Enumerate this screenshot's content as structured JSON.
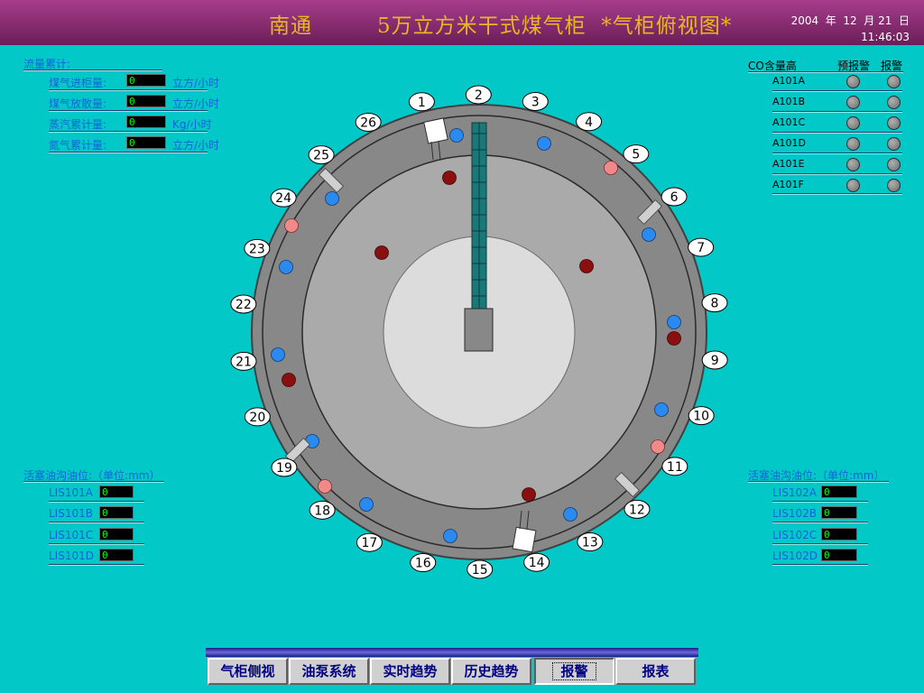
{
  "header": {
    "title": "南通　　　5万立方米干式煤气柜  *气柜俯视图*",
    "date": "2004  年  12  月 21  日",
    "time": "11:46:03"
  },
  "flow_section": {
    "title": "流量累计:",
    "rows": [
      {
        "label": "煤气进柜量:",
        "value": "0",
        "unit": "立方/小时"
      },
      {
        "label": "煤气放散量:",
        "value": "0",
        "unit": "立方/小时"
      },
      {
        "label": "蒸汽累计量:",
        "value": "0",
        "unit": "Kg/小时"
      },
      {
        "label": "氮气累计量:",
        "value": "0",
        "unit": "立方/小时"
      }
    ]
  },
  "co_section": {
    "title": "CO含量高",
    "col_pre": "预报警",
    "col_alarm": "报警",
    "rows": [
      {
        "label": "A101A"
      },
      {
        "label": "A101B"
      },
      {
        "label": "A101C"
      },
      {
        "label": "A101D"
      },
      {
        "label": "A101E"
      },
      {
        "label": "A101F"
      }
    ]
  },
  "oil_left": {
    "title": "活塞油沟油位:（单位:mm）",
    "rows": [
      {
        "label": "LIS101A",
        "value": "0"
      },
      {
        "label": "LIS101B",
        "value": "0"
      },
      {
        "label": "LIS101C",
        "value": "0"
      },
      {
        "label": "LIS101D",
        "value": "0"
      }
    ]
  },
  "oil_right": {
    "title": "活塞油沟油位:（单位:mm）",
    "rows": [
      {
        "label": "LIS102A",
        "value": "0"
      },
      {
        "label": "LIS102B",
        "value": "0"
      },
      {
        "label": "LIS102C",
        "value": "0"
      },
      {
        "label": "LIS102D",
        "value": "0"
      }
    ]
  },
  "column_labels": [
    "1",
    "2",
    "3",
    "4",
    "5",
    "6",
    "7",
    "8",
    "9",
    "10",
    "11",
    "12",
    "13",
    "14",
    "15",
    "16",
    "17",
    "18",
    "19",
    "20",
    "21",
    "22",
    "23",
    "24",
    "25",
    "26"
  ],
  "nav": [
    {
      "label": "气柜侧视"
    },
    {
      "label": "油泵系统"
    },
    {
      "label": "实时趋势"
    },
    {
      "label": "历史趋势"
    },
    {
      "label": "报警"
    },
    {
      "label": "报表"
    }
  ],
  "colors": {
    "background": "#03c8c8",
    "title_text": "#e8b820",
    "label_blue": "#1463d8",
    "value_green": "#00ff00",
    "dot_blue": "#2a8af0",
    "dot_pink": "#f08a8a",
    "dot_darkred": "#8a1010"
  }
}
